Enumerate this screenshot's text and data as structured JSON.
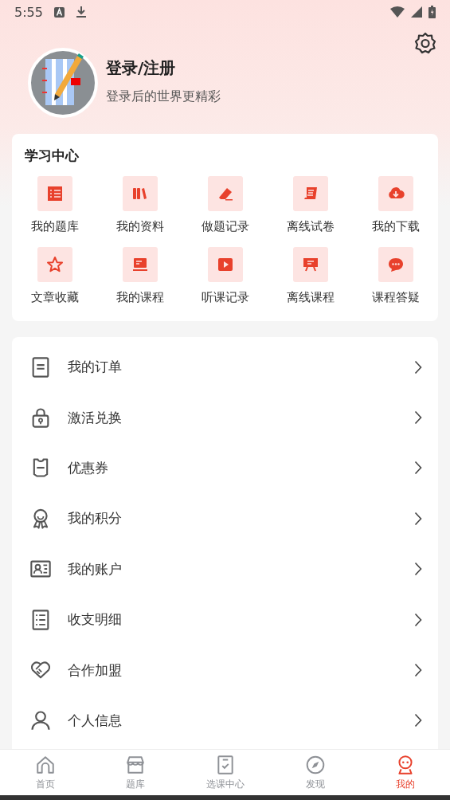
{
  "status_bar": {
    "time": "5:55"
  },
  "profile": {
    "title": "登录/注册",
    "subtitle": "登录后的世界更精彩"
  },
  "study_center": {
    "title": "学习中心",
    "items": [
      {
        "label": "我的题库"
      },
      {
        "label": "我的资料"
      },
      {
        "label": "做题记录"
      },
      {
        "label": "离线试卷"
      },
      {
        "label": "我的下载"
      },
      {
        "label": "文章收藏"
      },
      {
        "label": "我的课程"
      },
      {
        "label": "听课记录"
      },
      {
        "label": "离线课程"
      },
      {
        "label": "课程答疑"
      }
    ]
  },
  "menu": [
    {
      "label": "我的订单"
    },
    {
      "label": "激活兑换"
    },
    {
      "label": "优惠券"
    },
    {
      "label": "我的积分"
    },
    {
      "label": "我的账户"
    },
    {
      "label": "收支明细"
    },
    {
      "label": "合作加盟"
    },
    {
      "label": "个人信息"
    }
  ],
  "bottom_nav": [
    {
      "label": "首页",
      "selected": false
    },
    {
      "label": "题库",
      "selected": false
    },
    {
      "label": "选课中心",
      "selected": false
    },
    {
      "label": "发现",
      "selected": false
    },
    {
      "label": "我的",
      "selected": true
    }
  ]
}
